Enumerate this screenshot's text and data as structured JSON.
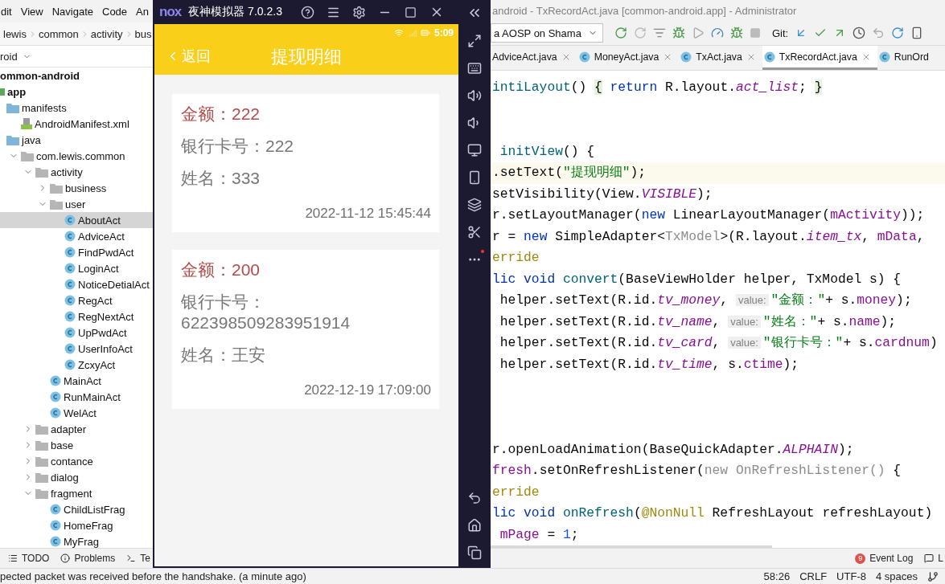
{
  "ide_menu": [
    "dit",
    "View",
    "Navigate",
    "Code",
    "An"
  ],
  "breadcrumb": [
    "lewis",
    "common",
    "activity",
    "bus"
  ],
  "project_view": {
    "label": "roid"
  },
  "tree": [
    {
      "label": "ommon-android",
      "kind": "project",
      "selected": false,
      "children": [
        {
          "label": "app",
          "kind": "module",
          "selected": false,
          "children": [
            {
              "label": "manifests",
              "kind": "source-folder",
              "selected": false,
              "children": [
                {
                  "label": "AndroidManifest.xml",
                  "kind": "manifest",
                  "selected": false
                }
              ]
            },
            {
              "label": "java",
              "kind": "source-folder",
              "selected": false,
              "children": [
                {
                  "label": "com.lewis.common",
                  "kind": "package",
                  "expanded": true,
                  "selected": false,
                  "children": [
                    {
                      "label": "activity",
                      "kind": "package",
                      "expanded": true,
                      "selected": false,
                      "children": [
                        {
                          "label": "business",
                          "kind": "package",
                          "expanded": false,
                          "selected": false
                        },
                        {
                          "label": "user",
                          "kind": "package",
                          "expanded": true,
                          "selected": false,
                          "children": [
                            {
                              "label": "AboutAct",
                              "kind": "class",
                              "selected": true
                            },
                            {
                              "label": "AdviceAct",
                              "kind": "class",
                              "selected": false
                            },
                            {
                              "label": "FindPwdAct",
                              "kind": "class",
                              "selected": false
                            },
                            {
                              "label": "LoginAct",
                              "kind": "class",
                              "selected": false
                            },
                            {
                              "label": "NoticeDetialAct",
                              "kind": "class",
                              "selected": false
                            },
                            {
                              "label": "RegAct",
                              "kind": "class",
                              "selected": false
                            },
                            {
                              "label": "RegNextAct",
                              "kind": "class",
                              "selected": false
                            },
                            {
                              "label": "UpPwdAct",
                              "kind": "class",
                              "selected": false
                            },
                            {
                              "label": "UserInfoAct",
                              "kind": "class",
                              "selected": false
                            },
                            {
                              "label": "ZcxyAct",
                              "kind": "class",
                              "selected": false
                            }
                          ]
                        },
                        {
                          "label": "MainAct",
                          "kind": "class",
                          "selected": false
                        },
                        {
                          "label": "RunMainAct",
                          "kind": "class",
                          "selected": false
                        },
                        {
                          "label": "WelAct",
                          "kind": "class",
                          "selected": false
                        }
                      ]
                    },
                    {
                      "label": "adapter",
                      "kind": "package",
                      "expanded": false,
                      "selected": false
                    },
                    {
                      "label": "base",
                      "kind": "package",
                      "expanded": false,
                      "selected": false
                    },
                    {
                      "label": "contance",
                      "kind": "package",
                      "expanded": false,
                      "selected": false
                    },
                    {
                      "label": "dialog",
                      "kind": "package",
                      "expanded": false,
                      "selected": false
                    },
                    {
                      "label": "fragment",
                      "kind": "package",
                      "expanded": true,
                      "selected": false,
                      "children": [
                        {
                          "label": "ChildListFrag",
                          "kind": "class",
                          "selected": false
                        },
                        {
                          "label": "HomeFrag",
                          "kind": "class",
                          "selected": false
                        },
                        {
                          "label": "MyFrag",
                          "kind": "class",
                          "selected": false
                        }
                      ]
                    }
                  ]
                }
              ]
            }
          ]
        }
      ]
    }
  ],
  "left_tool_strip": [
    {
      "label": "TODO",
      "kind": "todo"
    },
    {
      "label": "Problems",
      "kind": "problems"
    },
    {
      "label": "Te",
      "kind": "terminal"
    }
  ],
  "emulator": {
    "logo": "nox",
    "title": "夜神模拟器 7.0.2.3",
    "status_time": "5:09",
    "back_label": "返回",
    "page_title": "提现明细",
    "records": [
      {
        "amount": "金额：222",
        "card": "银行卡号：222",
        "name": "姓名：333",
        "time": "2022-11-12 15:45:44"
      },
      {
        "amount": "金额：200",
        "card": "银行卡号：622398509283951914",
        "name": "姓名：王安",
        "time": "2022-12-19 17:09:00"
      }
    ]
  },
  "editor": {
    "window_title": "android - TxRecordAct.java [common-android.app] - Administrator",
    "device": "a AOSP on Shama",
    "git_label": "Git:",
    "tabs": [
      {
        "label": "AdviceAct.java",
        "selected": false,
        "icon": false,
        "closable": true
      },
      {
        "label": "MoneyAct.java",
        "selected": false,
        "icon": true,
        "closable": true
      },
      {
        "label": "TxAct.java",
        "selected": false,
        "icon": true,
        "closable": true
      },
      {
        "label": "TxRecordAct.java",
        "selected": true,
        "icon": true,
        "closable": true
      },
      {
        "label": "RunOrd",
        "selected": false,
        "icon": true,
        "closable": false
      }
    ],
    "lines": [
      {
        "current": false,
        "tokens": [
          {
            "kind": "decl",
            "text": "intiLayout"
          },
          {
            "kind": "plain",
            "text": "() "
          },
          {
            "kind": "brace",
            "text": "{"
          },
          {
            "kind": "keyword",
            "text": " return"
          },
          {
            "kind": "plain",
            "text": " R.layout."
          },
          {
            "kind": "constant",
            "text": "act_list"
          },
          {
            "kind": "plain",
            "text": "; "
          },
          {
            "kind": "brace",
            "text": "}"
          }
        ]
      },
      {
        "current": false
      },
      {
        "current": false
      },
      {
        "current": false,
        "tokens": [
          {
            "kind": "decl",
            "text": " initView"
          },
          {
            "kind": "plain",
            "text": "() {"
          }
        ]
      },
      {
        "current": true,
        "tokens": [
          {
            "kind": "plain",
            "text": ".setText("
          },
          {
            "kind": "string",
            "text": "\"提现明细\""
          },
          {
            "kind": "plain",
            "text": ");"
          }
        ]
      },
      {
        "current": false,
        "tokens": [
          {
            "kind": "plain",
            "text": "setVisibility(View."
          },
          {
            "kind": "constant",
            "text": "VISIBLE"
          },
          {
            "kind": "plain",
            "text": ");"
          }
        ]
      },
      {
        "current": false,
        "tokens": [
          {
            "kind": "plain",
            "text": "r.setLayoutManager("
          },
          {
            "kind": "keyword",
            "text": "new"
          },
          {
            "kind": "plain",
            "text": " LinearLayoutManager("
          },
          {
            "kind": "field",
            "text": "mActivity"
          },
          {
            "kind": "plain",
            "text": "));"
          }
        ]
      },
      {
        "current": false,
        "tokens": [
          {
            "kind": "plain",
            "text": "r = "
          },
          {
            "kind": "keyword",
            "text": "new"
          },
          {
            "kind": "plain",
            "text": " SimpleAdapter<"
          },
          {
            "kind": "muted",
            "text": "TxModel"
          },
          {
            "kind": "plain",
            "text": ">(R.layout."
          },
          {
            "kind": "constant",
            "text": "item_tx"
          },
          {
            "kind": "plain",
            "text": ", "
          },
          {
            "kind": "field",
            "text": "mData"
          },
          {
            "kind": "plain",
            "text": ","
          }
        ]
      },
      {
        "current": false,
        "tokens": [
          {
            "kind": "annotation",
            "text": "erride"
          }
        ]
      },
      {
        "current": false,
        "tokens": [
          {
            "kind": "keyword",
            "text": "lic void "
          },
          {
            "kind": "decl",
            "text": "convert"
          },
          {
            "kind": "plain",
            "text": "(BaseViewHolder helper, TxModel s) {"
          }
        ]
      },
      {
        "current": false,
        "tokens": [
          {
            "kind": "plain",
            "text": " helper.setText(R.id."
          },
          {
            "kind": "constant",
            "text": "tv_money"
          },
          {
            "kind": "plain",
            "text": ", "
          },
          {
            "kind": "hint",
            "text": "value:"
          },
          {
            "kind": "string",
            "text": "\"金额：\""
          },
          {
            "kind": "plain",
            "text": "+ s."
          },
          {
            "kind": "field",
            "text": "money"
          },
          {
            "kind": "plain",
            "text": ");"
          }
        ]
      },
      {
        "current": false,
        "tokens": [
          {
            "kind": "plain",
            "text": " helper.setText(R.id."
          },
          {
            "kind": "constant",
            "text": "tv_name"
          },
          {
            "kind": "plain",
            "text": ", "
          },
          {
            "kind": "hint",
            "text": "value:"
          },
          {
            "kind": "string",
            "text": "\"姓名：\""
          },
          {
            "kind": "plain",
            "text": "+ s."
          },
          {
            "kind": "field",
            "text": "name"
          },
          {
            "kind": "plain",
            "text": ");"
          }
        ]
      },
      {
        "current": false,
        "tokens": [
          {
            "kind": "plain",
            "text": " helper.setText(R.id."
          },
          {
            "kind": "constant",
            "text": "tv_card"
          },
          {
            "kind": "plain",
            "text": ", "
          },
          {
            "kind": "hint",
            "text": "value:"
          },
          {
            "kind": "string",
            "text": "\"银行卡号：\""
          },
          {
            "kind": "plain",
            "text": "+ s."
          },
          {
            "kind": "field",
            "text": "cardnum"
          },
          {
            "kind": "plain",
            "text": ")"
          }
        ]
      },
      {
        "current": false,
        "tokens": [
          {
            "kind": "plain",
            "text": " helper.setText(R.id."
          },
          {
            "kind": "constant",
            "text": "tv_time"
          },
          {
            "kind": "plain",
            "text": ", s."
          },
          {
            "kind": "field",
            "text": "ctime"
          },
          {
            "kind": "plain",
            "text": ");"
          }
        ]
      },
      {
        "current": false
      },
      {
        "current": false
      },
      {
        "current": false
      },
      {
        "current": false,
        "tokens": [
          {
            "kind": "plain",
            "text": "r.openLoadAnimation(BaseQuickAdapter."
          },
          {
            "kind": "constant",
            "text": "ALPHAIN"
          },
          {
            "kind": "plain",
            "text": ");"
          }
        ]
      },
      {
        "current": false,
        "tokens": [
          {
            "kind": "field",
            "text": "fresh"
          },
          {
            "kind": "plain",
            "text": ".setOnRefreshListener("
          },
          {
            "kind": "muted",
            "text": "new OnRefreshListener()"
          },
          {
            "kind": "plain",
            "text": " {"
          }
        ]
      },
      {
        "current": false,
        "tokens": [
          {
            "kind": "annotation",
            "text": "erride"
          }
        ]
      },
      {
        "current": false,
        "tokens": [
          {
            "kind": "keyword",
            "text": "lic void "
          },
          {
            "kind": "decl",
            "text": "onRefresh"
          },
          {
            "kind": "plain",
            "text": "("
          },
          {
            "kind": "annotation",
            "text": "@NonNull"
          },
          {
            "kind": "plain",
            "text": " RefreshLayout refreshLayout)"
          }
        ]
      },
      {
        "current": false,
        "tokens": [
          {
            "kind": "field",
            "text": " mPage"
          },
          {
            "kind": "plain",
            "text": " = "
          },
          {
            "kind": "number",
            "text": "1"
          },
          {
            "kind": "plain",
            "text": ";"
          }
        ]
      }
    ]
  },
  "editor_tool_strip": {
    "event_log": "Event Log",
    "event_count": "9",
    "cut_label": "L"
  },
  "status_bar": {
    "message": "pected packet was received before the handshake. (a minute ago)",
    "position": "58:26",
    "line_ending": "CRLF",
    "encoding": "UTF-8",
    "indent": "4 spaces"
  }
}
